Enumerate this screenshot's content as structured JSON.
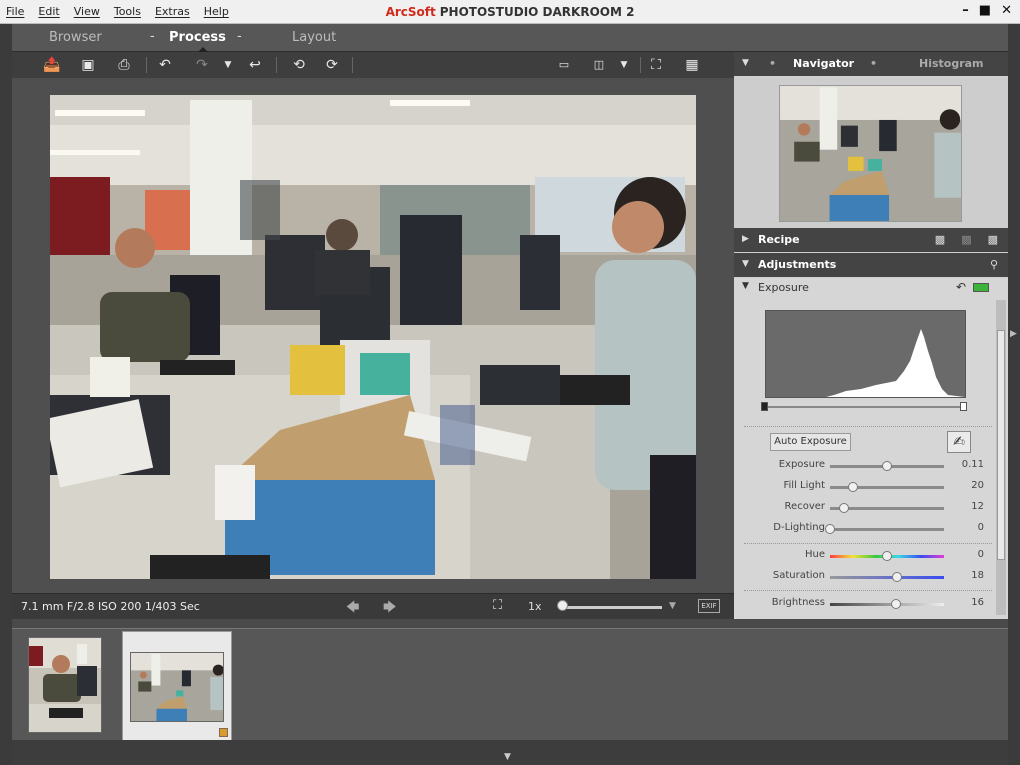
{
  "menu": [
    "File",
    "Edit",
    "View",
    "Tools",
    "Extras",
    "Help"
  ],
  "app": {
    "brand": "ArcSoft",
    "title": "PHOTOSTUDIO DARKROOM 2"
  },
  "window_controls": [
    "–",
    "■",
    "✕"
  ],
  "tabs": {
    "browser": "Browser",
    "process": "Process",
    "layout": "Layout"
  },
  "toolbar": {
    "icons": [
      "open-icon",
      "save-icon",
      "print-icon",
      "undo-icon",
      "redo-icon",
      "redo-dropdown-icon",
      "revert-icon",
      "rotate-left-icon",
      "rotate-right-icon",
      "single-view-icon",
      "compare-view-icon",
      "compare-dropdown-icon",
      "fit-screen-icon",
      "grid-icon"
    ]
  },
  "status": {
    "camera_info": "7.1 mm F/2.8 ISO 200 1/403 Sec",
    "zoom_level": "1x",
    "zoom_fraction": 0.0,
    "exif_label": "EXIF"
  },
  "panels": {
    "navigator": "Navigator",
    "histogram": "Histogram",
    "recipe": "Recipe",
    "adjustments": "Adjustments",
    "exposure_section": "Exposure"
  },
  "exposure": {
    "auto_button": "Auto Exposure",
    "sliders": [
      {
        "label": "Exposure",
        "value": "0.11",
        "fraction": 0.5,
        "track": "plain"
      },
      {
        "label": "Fill Light",
        "value": "20",
        "fraction": 0.2,
        "track": "plain"
      },
      {
        "label": "Recover",
        "value": "12",
        "fraction": 0.12,
        "track": "plain"
      },
      {
        "label": "D-Lighting",
        "value": "0",
        "fraction": 0.0,
        "track": "plain"
      },
      {
        "label": "Hue",
        "value": "0",
        "fraction": 0.5,
        "track": "hue"
      },
      {
        "label": "Saturation",
        "value": "18",
        "fraction": 0.59,
        "track": "sat"
      },
      {
        "label": "Brightness",
        "value": "16",
        "fraction": 0.58,
        "track": "bri"
      }
    ]
  },
  "filmstrip": {
    "count": 2,
    "selected_index": 1
  }
}
